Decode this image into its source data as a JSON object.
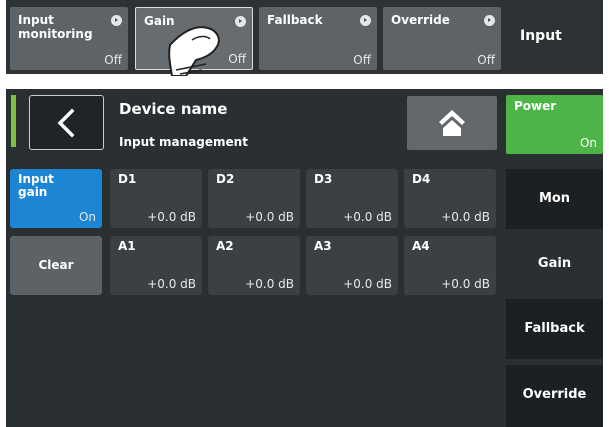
{
  "top_bar": {
    "buttons": [
      {
        "label": "Input monitoring",
        "state": "Off"
      },
      {
        "label": "Gain",
        "state": "Off"
      },
      {
        "label": "Fallback",
        "state": "Off"
      },
      {
        "label": "Override",
        "state": "Off"
      }
    ],
    "input_label": "Input"
  },
  "header": {
    "title": "Device name",
    "subtitle": "Input management"
  },
  "power": {
    "label": "Power",
    "state": "On"
  },
  "input_gain": {
    "label": "Input gain",
    "state": "On"
  },
  "clear": {
    "label": "Clear"
  },
  "channels_digital": [
    {
      "label": "D1",
      "value": "+0.0 dB"
    },
    {
      "label": "D2",
      "value": "+0.0 dB"
    },
    {
      "label": "D3",
      "value": "+0.0 dB"
    },
    {
      "label": "D4",
      "value": "+0.0 dB"
    }
  ],
  "channels_analog": [
    {
      "label": "A1",
      "value": "+0.0 dB"
    },
    {
      "label": "A2",
      "value": "+0.0 dB"
    },
    {
      "label": "A3",
      "value": "+0.0 dB"
    },
    {
      "label": "A4",
      "value": "+0.0 dB"
    }
  ],
  "sidebar": {
    "items": [
      {
        "label": "Mon"
      },
      {
        "label": "Gain"
      },
      {
        "label": "Fallback"
      },
      {
        "label": "Override"
      }
    ],
    "selected": "Gain"
  },
  "colors": {
    "power_on": "#4db547",
    "input_gain_active": "#1c86d4",
    "status_bar": "#7cc43f"
  },
  "icons": {
    "back": "chevron-left-icon",
    "home": "home-icon",
    "mini_arrow": "arrow-right-circle-icon",
    "hand": "hand-pointer-icon"
  }
}
